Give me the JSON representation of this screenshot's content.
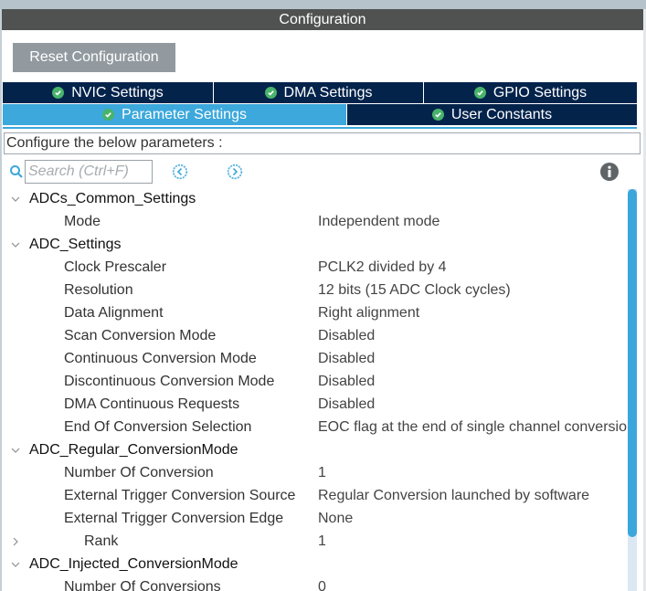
{
  "header": {
    "title": "Configuration"
  },
  "toolbar": {
    "reset_label": "Reset Configuration"
  },
  "tabs": {
    "row1": [
      {
        "label": "NVIC Settings",
        "icon": "check-circle-icon",
        "active": false
      },
      {
        "label": "DMA Settings",
        "icon": "check-circle-icon",
        "active": false
      },
      {
        "label": "GPIO Settings",
        "icon": "check-circle-icon",
        "active": false
      }
    ],
    "row2": [
      {
        "label": "Parameter Settings",
        "icon": "check-circle-icon",
        "active": true
      },
      {
        "label": "User Constants",
        "icon": "check-circle-icon",
        "active": false
      }
    ]
  },
  "description": "Configure the below parameters :",
  "search": {
    "placeholder": "Search (Ctrl+F)",
    "value": ""
  },
  "colors": {
    "header_bg": "#505251",
    "tab_bg": "#03234b",
    "tab_active_bg": "#3ca8dc",
    "check_green": "#49b36b",
    "scroll_thumb": "#3ba6dc"
  },
  "tree": [
    {
      "type": "group",
      "label": "ADCs_Common_Settings",
      "expanded": true
    },
    {
      "type": "param",
      "label": "Mode",
      "value": "Independent mode"
    },
    {
      "type": "group",
      "label": "ADC_Settings",
      "expanded": true
    },
    {
      "type": "param",
      "label": "Clock Prescaler",
      "value": "PCLK2 divided by 4"
    },
    {
      "type": "param",
      "label": "Resolution",
      "value": "12 bits (15 ADC Clock cycles)"
    },
    {
      "type": "param",
      "label": "Data Alignment",
      "value": "Right alignment"
    },
    {
      "type": "param",
      "label": "Scan Conversion Mode",
      "value": "Disabled"
    },
    {
      "type": "param",
      "label": "Continuous Conversion Mode",
      "value": "Disabled"
    },
    {
      "type": "param",
      "label": "Discontinuous Conversion Mode",
      "value": "Disabled"
    },
    {
      "type": "param",
      "label": "DMA Continuous Requests",
      "value": "Disabled"
    },
    {
      "type": "param",
      "label": "End Of Conversion Selection",
      "value": "EOC flag at the end of single channel conversion."
    },
    {
      "type": "group",
      "label": "ADC_Regular_ConversionMode",
      "expanded": true
    },
    {
      "type": "param",
      "label": "Number Of Conversion",
      "value": "1"
    },
    {
      "type": "param",
      "label": "External Trigger Conversion Source",
      "value": "Regular Conversion launched by software"
    },
    {
      "type": "param",
      "label": "External Trigger Conversion Edge",
      "value": "None"
    },
    {
      "type": "subgroup",
      "label": "Rank",
      "value": "1",
      "expanded": false
    },
    {
      "type": "group",
      "label": "ADC_Injected_ConversionMode",
      "expanded": true
    },
    {
      "type": "param",
      "label": "Number Of Conversions",
      "value": "0"
    }
  ]
}
